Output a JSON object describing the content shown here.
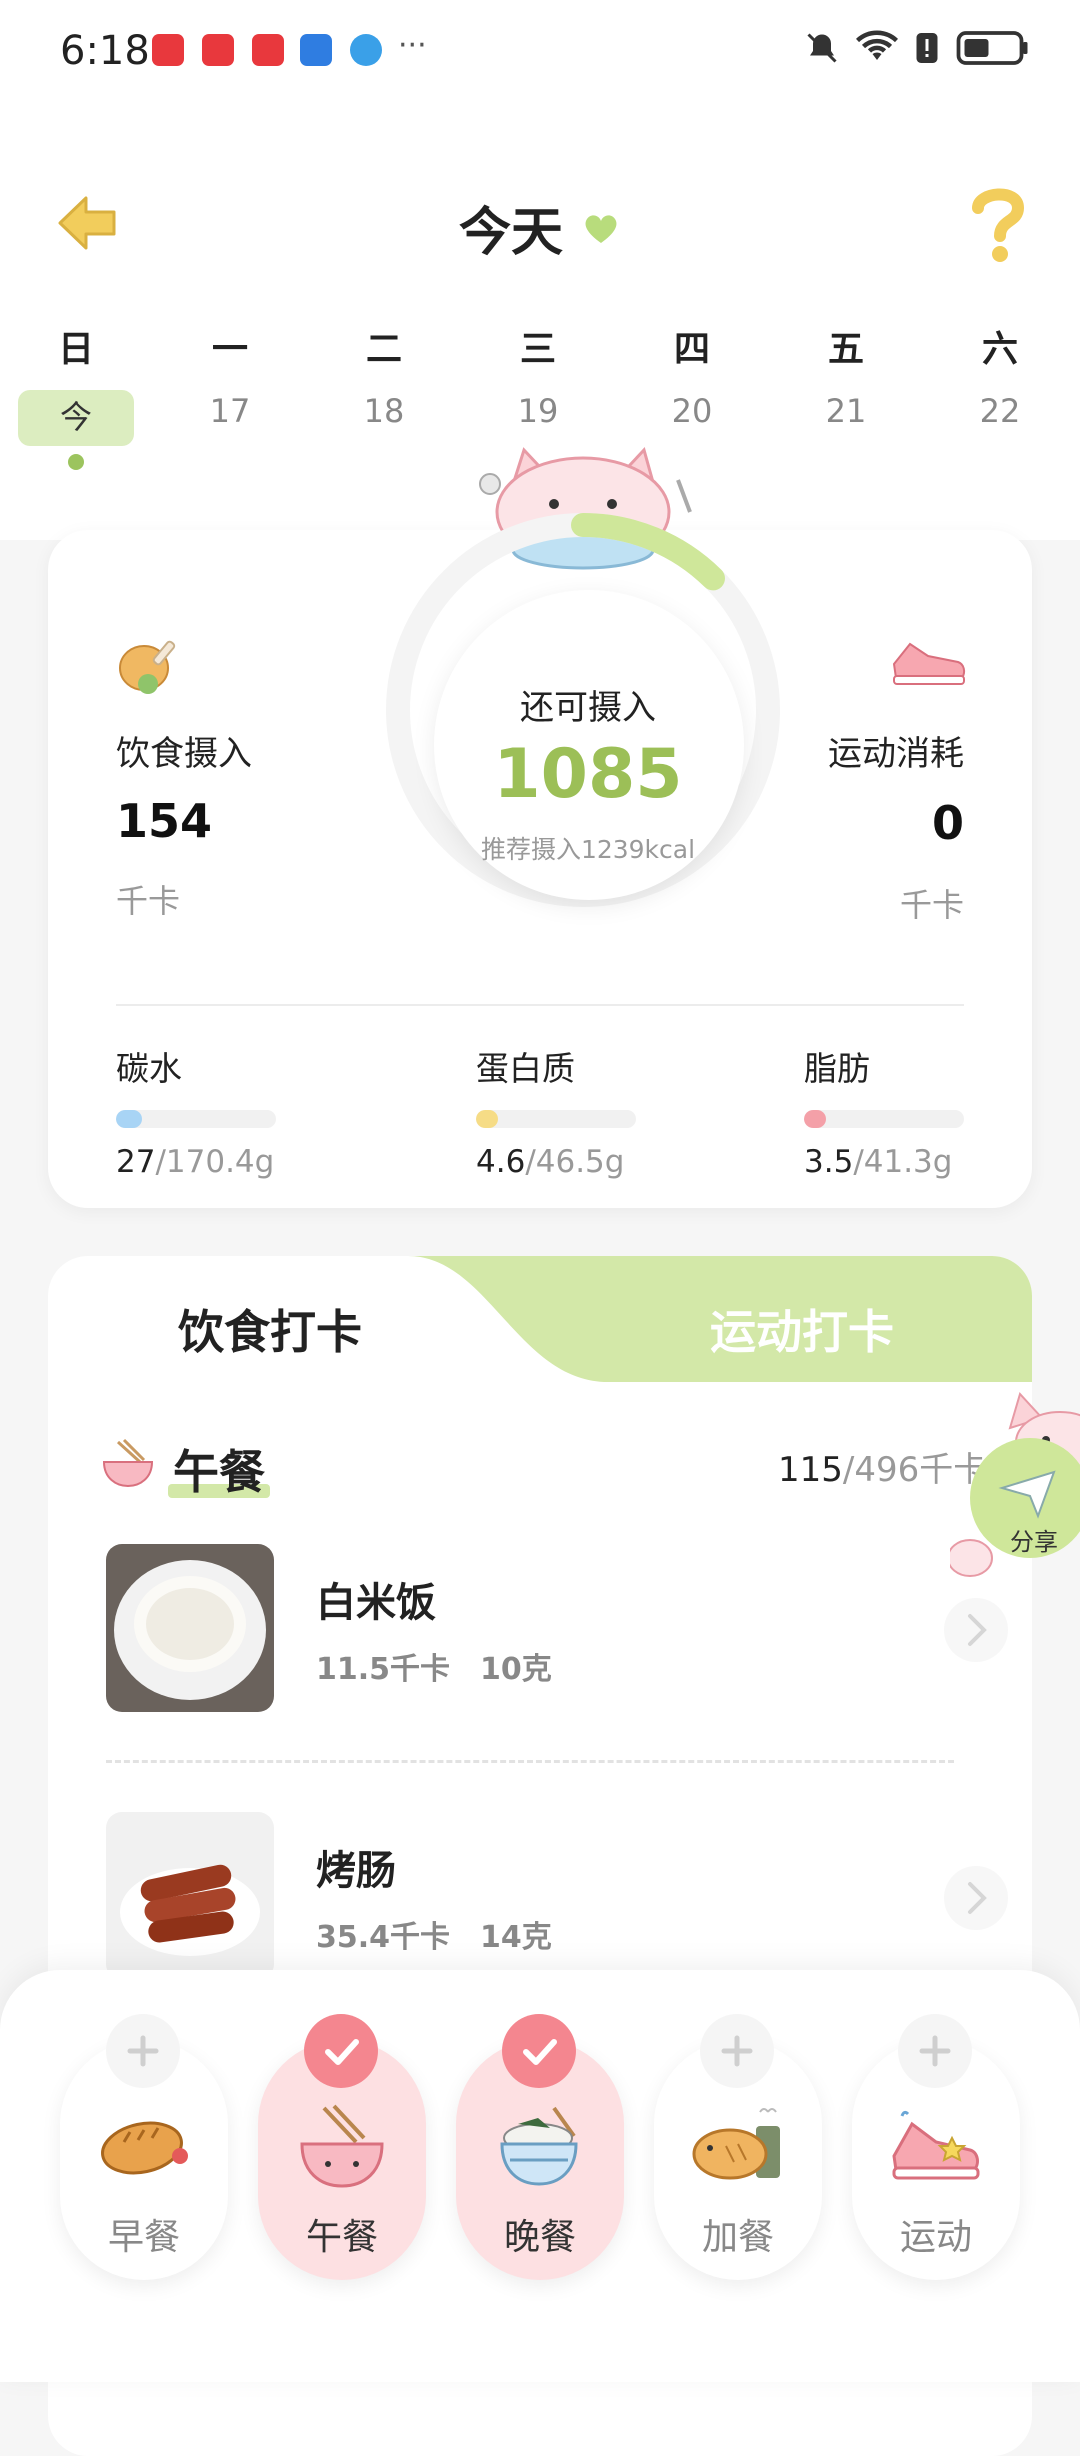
{
  "status_bar": {
    "time": "6:18",
    "app_icons": [
      "xiaohongshu-icon",
      "huawei-mall-icon",
      "huawei-mall-icon",
      "weather-icon",
      "browser-icon"
    ],
    "overflow": "···",
    "right_icons": [
      "mute-icon",
      "wifi-icon",
      "battery-saver-icon",
      "battery-icon"
    ]
  },
  "header": {
    "title": "今天",
    "weekdays": [
      "日",
      "一",
      "二",
      "三",
      "四",
      "五",
      "六"
    ],
    "dates": [
      "今",
      "17",
      "18",
      "19",
      "20",
      "21",
      "22"
    ]
  },
  "summary": {
    "intake_label": "饮食摄入",
    "intake_value": "154",
    "intake_unit": "千卡",
    "burn_label": "运动消耗",
    "burn_value": "0",
    "burn_unit": "千卡",
    "remaining_label": "还可摄入",
    "remaining_value": "1085",
    "recommended": "推荐摄入1239kcal",
    "progress_fraction": 0.124
  },
  "macros": [
    {
      "name": "碳水",
      "value": "27",
      "target": "/170.4g",
      "color": "#a8d4f5",
      "fraction": 0.16
    },
    {
      "name": "蛋白质",
      "value": "4.6",
      "target": "/46.5g",
      "color": "#f6dc86",
      "fraction": 0.1
    },
    {
      "name": "脂肪",
      "value": "3.5",
      "target": "/41.3g",
      "color": "#f4a0a8",
      "fraction": 0.085
    }
  ],
  "tabs": {
    "diet": "饮食打卡",
    "exercise": "运动打卡"
  },
  "meal": {
    "title": "午餐",
    "kcal_value": "115",
    "kcal_target": "/496千卡",
    "foods": [
      {
        "name": "白米饭",
        "kcal": "11.5千卡",
        "weight": "10克"
      },
      {
        "name": "烤肠",
        "kcal": "35.4千卡",
        "weight": "14克"
      }
    ]
  },
  "share": {
    "label": "分享"
  },
  "quick_actions": [
    {
      "label": "早餐",
      "done": false
    },
    {
      "label": "午餐",
      "done": true
    },
    {
      "label": "晚餐",
      "done": true
    },
    {
      "label": "加餐",
      "done": false
    },
    {
      "label": "运动",
      "done": false
    }
  ],
  "colors": {
    "accent_green": "#9cbf57",
    "light_green": "#d3e8a8",
    "pink": "#f4868f",
    "yellow_icon": "#f2cd5c"
  }
}
